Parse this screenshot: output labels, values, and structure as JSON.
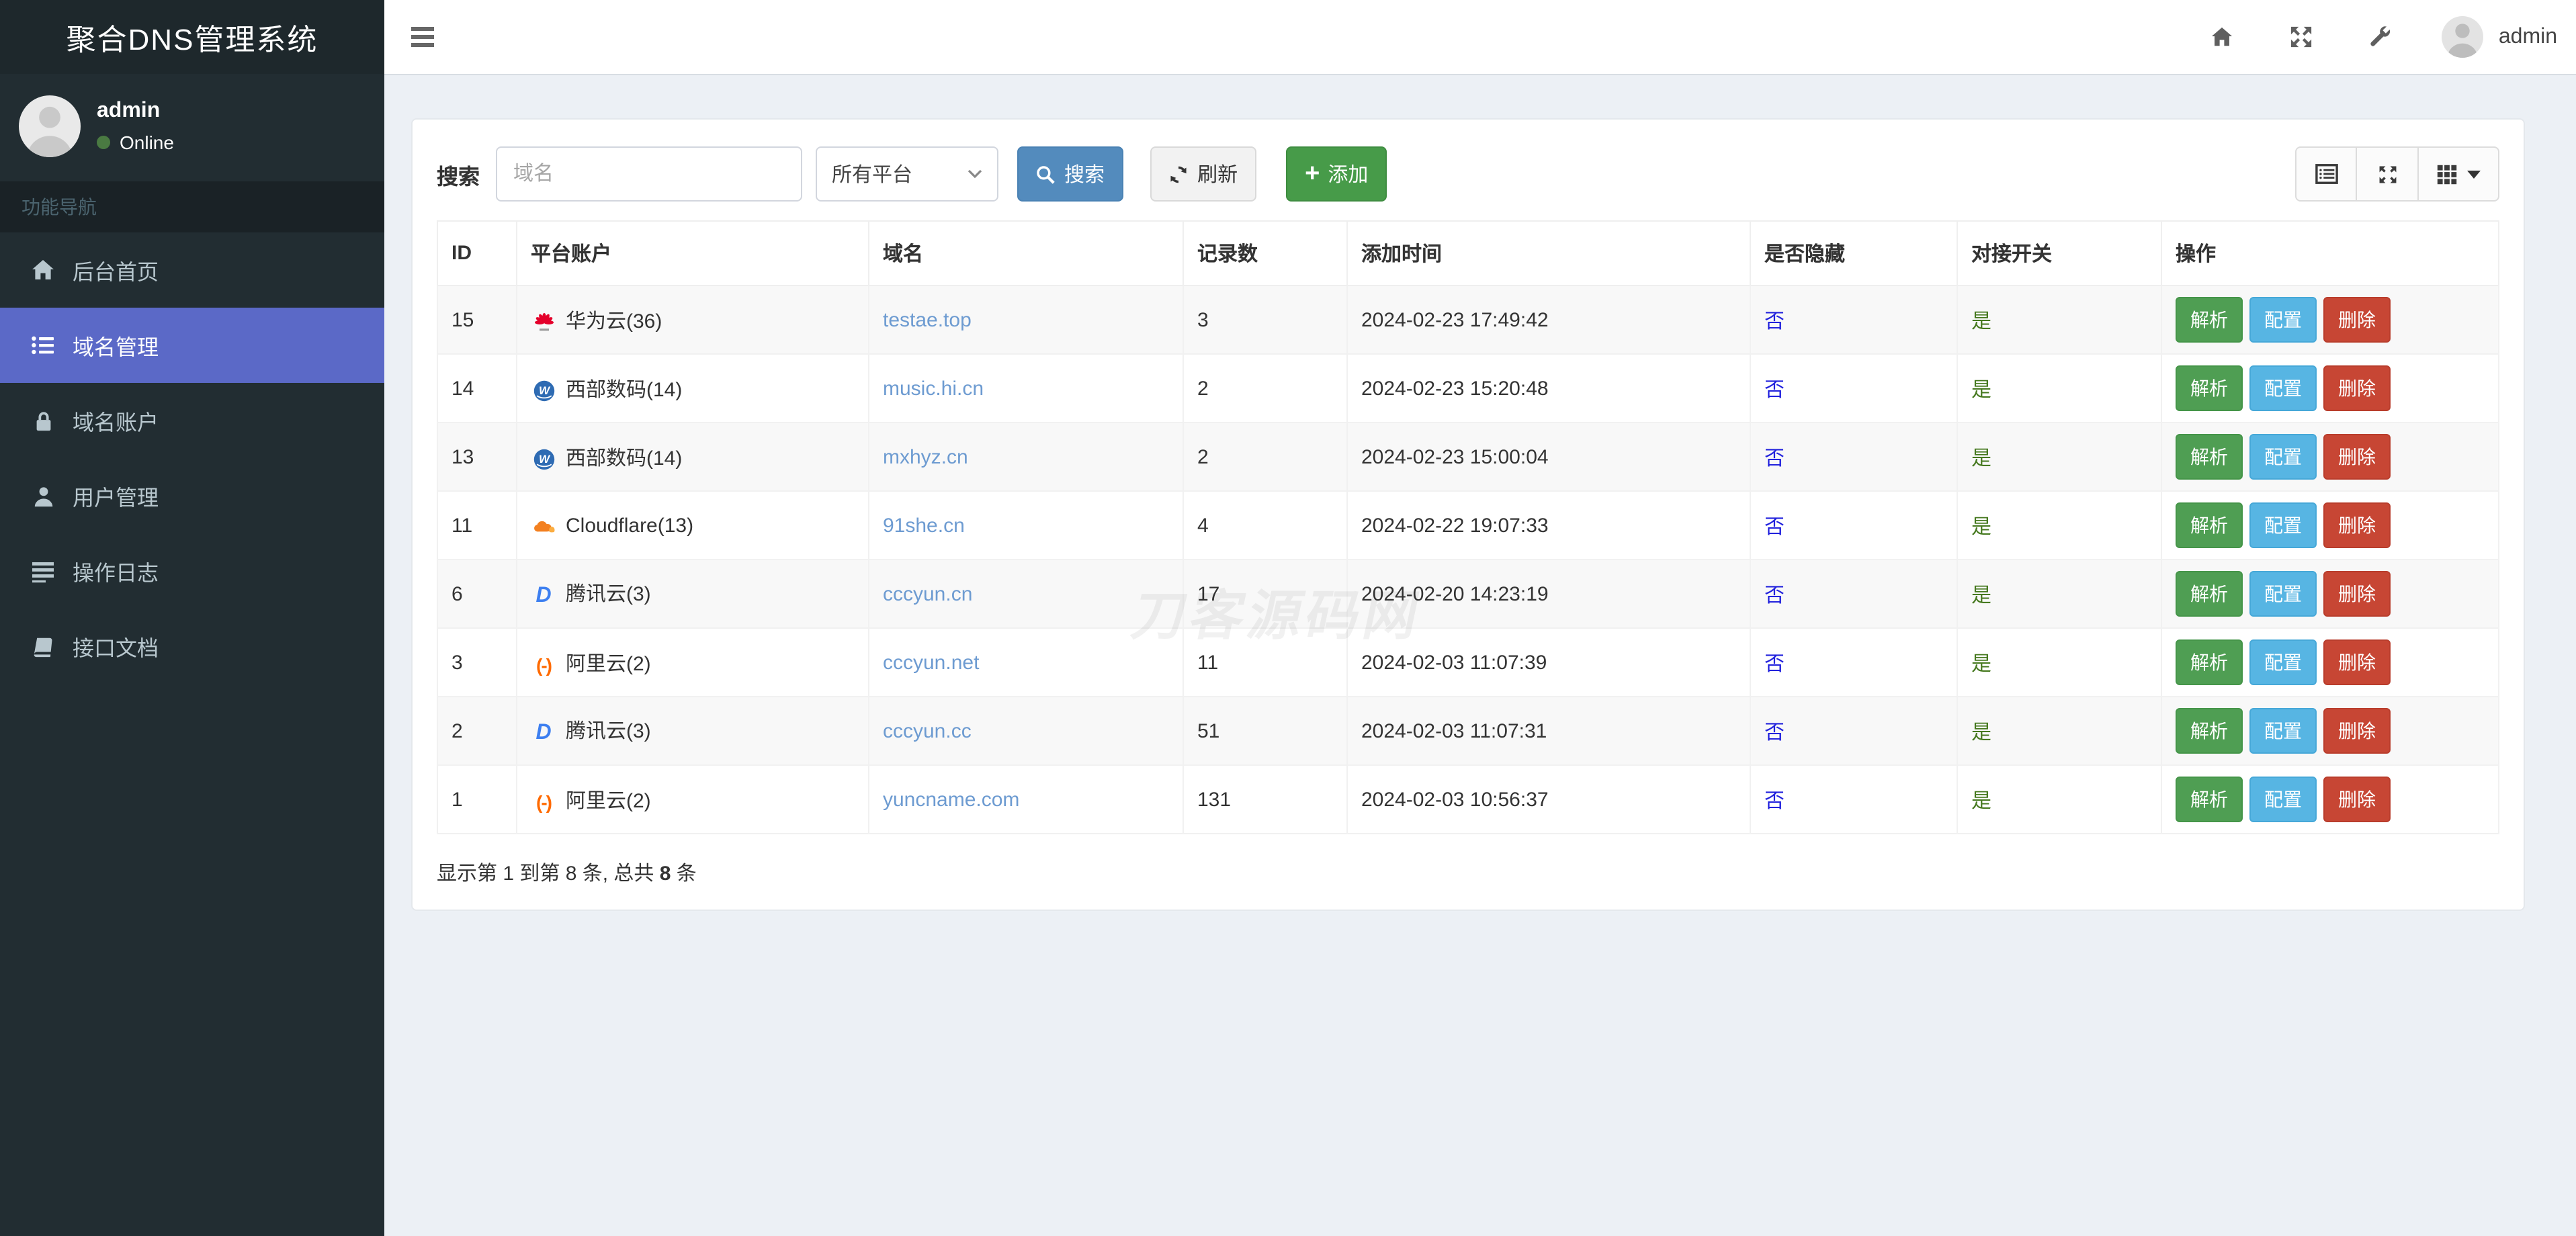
{
  "app": {
    "title": "聚合DNS管理系统"
  },
  "navbar": {
    "username": "admin",
    "icons": [
      "home-icon",
      "fullscreen-icon",
      "wrench-icon",
      "avatar"
    ]
  },
  "sidebar": {
    "user": {
      "name": "admin",
      "status": "Online"
    },
    "nav_header": "功能导航",
    "items": [
      {
        "label": "后台首页",
        "icon": "home-icon",
        "active": false
      },
      {
        "label": "域名管理",
        "icon": "list-icon",
        "active": true
      },
      {
        "label": "域名账户",
        "icon": "lock-icon",
        "active": false
      },
      {
        "label": "用户管理",
        "icon": "user-icon",
        "active": false
      },
      {
        "label": "操作日志",
        "icon": "log-icon",
        "active": false
      },
      {
        "label": "接口文档",
        "icon": "book-icon",
        "active": false
      }
    ]
  },
  "toolbar": {
    "search_label": "搜索",
    "search_placeholder": "域名",
    "platform_select": "所有平台",
    "search_button": "搜索",
    "refresh_button": "刷新",
    "add_button": "添加",
    "view_buttons": [
      "detail-view-icon",
      "fullscreen-icon",
      "columns-grid-icon"
    ]
  },
  "table": {
    "headers": [
      "ID",
      "平台账户",
      "域名",
      "记录数",
      "添加时间",
      "是否隐藏",
      "对接开关",
      "操作"
    ],
    "actions": [
      "解析",
      "配置",
      "删除"
    ],
    "rows": [
      {
        "id": "15",
        "platform": "华为云(36)",
        "platform_icon": "huawei",
        "domain": "testae.top",
        "records": "3",
        "added": "2024-02-23 17:49:42",
        "hidden": "否",
        "switch": "是"
      },
      {
        "id": "14",
        "platform": "西部数码(14)",
        "platform_icon": "west",
        "domain": "music.hi.cn",
        "records": "2",
        "added": "2024-02-23 15:20:48",
        "hidden": "否",
        "switch": "是"
      },
      {
        "id": "13",
        "platform": "西部数码(14)",
        "platform_icon": "west",
        "domain": "mxhyz.cn",
        "records": "2",
        "added": "2024-02-23 15:00:04",
        "hidden": "否",
        "switch": "是"
      },
      {
        "id": "11",
        "platform": "Cloudflare(13)",
        "platform_icon": "cloudflare",
        "domain": "91she.cn",
        "records": "4",
        "added": "2024-02-22 19:07:33",
        "hidden": "否",
        "switch": "是"
      },
      {
        "id": "6",
        "platform": "腾讯云(3)",
        "platform_icon": "dnspod",
        "domain": "cccyun.cn",
        "records": "17",
        "added": "2024-02-20 14:23:19",
        "hidden": "否",
        "switch": "是"
      },
      {
        "id": "3",
        "platform": "阿里云(2)",
        "platform_icon": "aliyun",
        "domain": "cccyun.net",
        "records": "11",
        "added": "2024-02-03 11:07:39",
        "hidden": "否",
        "switch": "是"
      },
      {
        "id": "2",
        "platform": "腾讯云(3)",
        "platform_icon": "dnspod",
        "domain": "cccyun.cc",
        "records": "51",
        "added": "2024-02-03 11:07:31",
        "hidden": "否",
        "switch": "是"
      },
      {
        "id": "1",
        "platform": "阿里云(2)",
        "platform_icon": "aliyun",
        "domain": "yuncname.com",
        "records": "131",
        "added": "2024-02-03 10:56:37",
        "hidden": "否",
        "switch": "是"
      }
    ]
  },
  "pagination": {
    "prefix": "显示第 1 到第 8 条, 总共 ",
    "total": "8",
    "suffix": " 条"
  },
  "watermark": "刀客源码网",
  "colors": {
    "sidebar_bg": "#222d32",
    "sidebar_active": "#5b69c7",
    "content_bg": "#ecf0f5",
    "search_btn": "#538bbd",
    "add_btn": "#479b49",
    "resolve_btn": "#4f9e53",
    "config_btn": "#57b5e3",
    "delete_btn": "#c74634",
    "link": "#6d9bd1",
    "flag_no": "#2222dd",
    "flag_yes": "#46791f",
    "online_dot": "#4a7a42"
  }
}
